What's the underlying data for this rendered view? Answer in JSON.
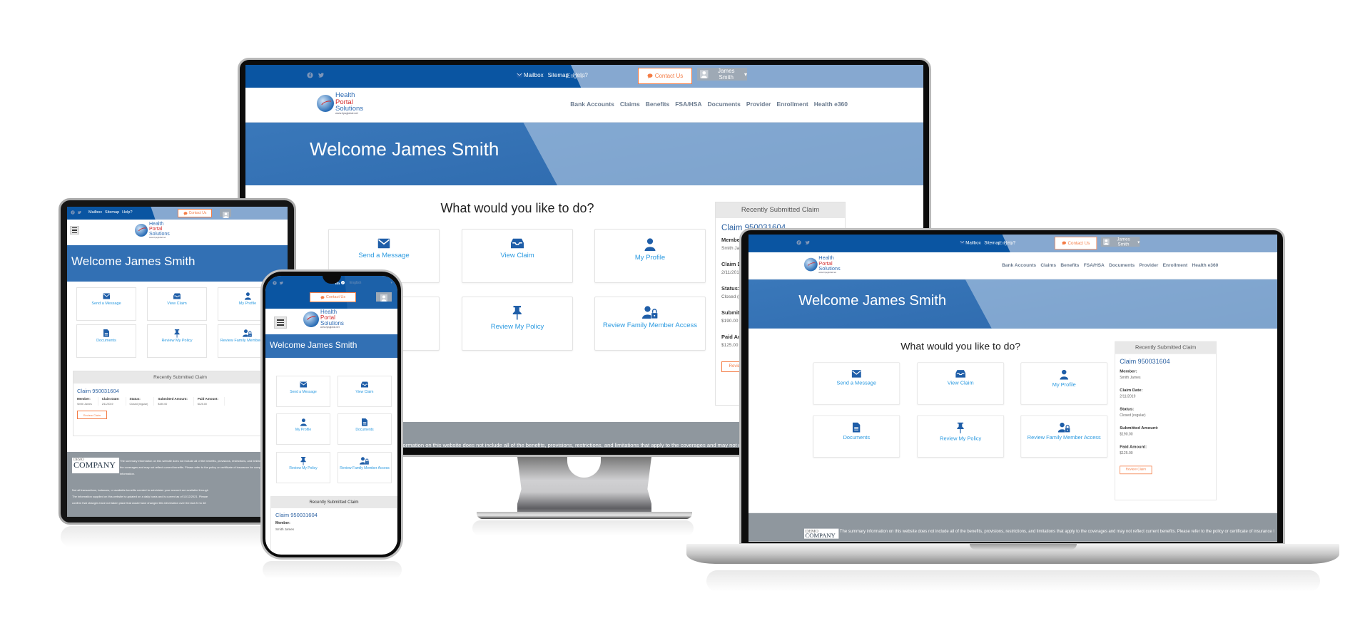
{
  "site": {
    "topbar": {
      "links": [
        "Mailbox",
        "Sitemap",
        "Help?"
      ],
      "language": "English",
      "contact_label": "Contact Us",
      "user_name": "James Smith"
    },
    "logo": {
      "line1": "Health",
      "line2": "Portal",
      "line3": "Solutions",
      "url_text": "www.hpsglobal.net"
    },
    "nav": [
      "Bank Accounts",
      "Claims",
      "Benefits",
      "FSA/HSA",
      "Documents",
      "Provider",
      "Enrollment",
      "Health e360"
    ],
    "welcome": "Welcome James Smith",
    "prompt": "What would you like to do?",
    "actions": [
      {
        "label": "Send a Message",
        "icon": "envelope-icon"
      },
      {
        "label": "View Claim",
        "icon": "inbox-icon"
      },
      {
        "label": "My Profile",
        "icon": "user-icon"
      },
      {
        "label": "Documents",
        "icon": "file-icon"
      },
      {
        "label": "Review My Policy",
        "icon": "pushpin-icon"
      },
      {
        "label": "Review Family Member Access",
        "icon": "user-lock-icon"
      }
    ],
    "claim": {
      "header": "Recently Submitted Claim",
      "title": "Claim 950031604",
      "fields": [
        {
          "label": "Member:",
          "value": "Smith James"
        },
        {
          "label": "Claim Date:",
          "value": "2/11/2019"
        },
        {
          "label": "Status:",
          "value": "Closed (regular)"
        },
        {
          "label": "Submitted Amount:",
          "value": "$190.00"
        },
        {
          "label": "Paid Amount:",
          "value": "$125.00"
        }
      ],
      "button": "Review Claim"
    },
    "footer": {
      "logo_top": "DEMO",
      "logo_bottom": "COMPANY",
      "disclaimer_1": "The summary information on this website does not include all of the benefits, provisions, restrictions, and limitations that apply to the coverages and may not reflect current benefits. Please refer to the policy or certificate of insurance for complete benefit information.",
      "disclaimer_2": "Not all transactions, balances, or available benefits needed to administer your account are available through",
      "disclaimer_3": "The information supplied on this website is updated on a daily basis and is current as of 11/12/2021. Please",
      "disclaimer_4": "confirm that changes have not taken place that would have changed this information over the last 24 to 48"
    }
  },
  "colors": {
    "primary_blue": "#0a55a2",
    "hero_blue": "#3270b4",
    "link_blue": "#2b9ae0",
    "accent_orange": "#f47c45",
    "footer_gray": "#8f979e"
  }
}
